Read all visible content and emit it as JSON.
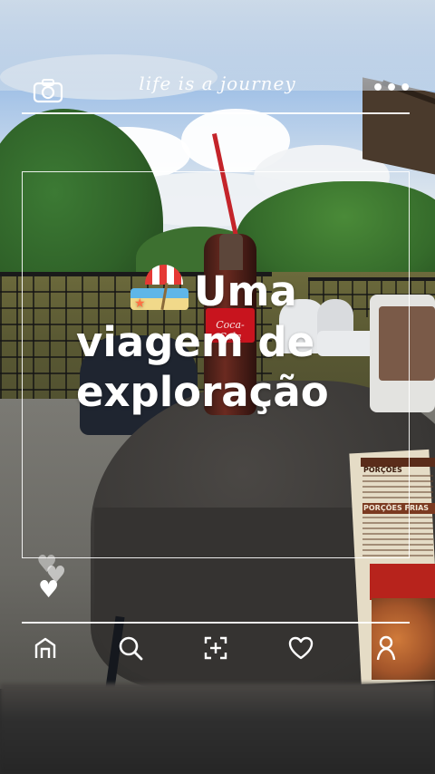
{
  "header": {
    "tagline": "life is a journey",
    "camera_icon": "camera-icon",
    "more_icon": "more-dots-icon",
    "more_label": "•••"
  },
  "post": {
    "headline_line1": "Uma",
    "headline_line2": "viagem de",
    "headline_line3": "exploração",
    "emoji": "beach-umbrella-icon"
  },
  "photo": {
    "bottle_label": "Coca-Cola",
    "menu_section_1": "PORÇÕES",
    "menu_section_2": "PORÇÕES FRIAS"
  },
  "reactions": {
    "icon": "heart-icon"
  },
  "bottom_nav": {
    "items": [
      {
        "icon": "home-icon"
      },
      {
        "icon": "search-icon"
      },
      {
        "icon": "add-post-icon"
      },
      {
        "icon": "likes-heart-icon"
      },
      {
        "icon": "profile-icon"
      }
    ]
  },
  "colors": {
    "overlay_white": "#ffffff",
    "bottle_red": "#c8141e",
    "umbrella_red": "#e53935"
  }
}
